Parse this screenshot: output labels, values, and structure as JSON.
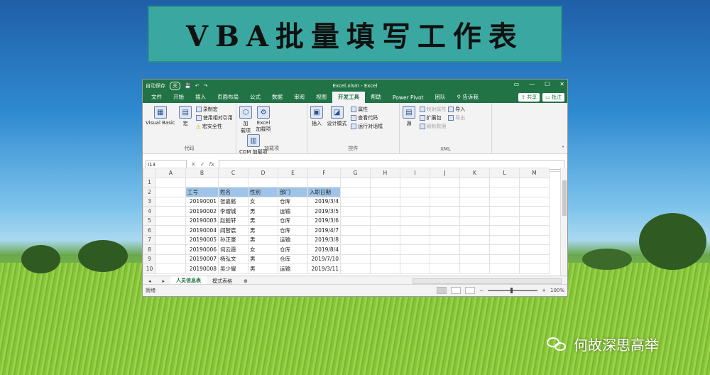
{
  "banner": {
    "title": "VBA批量填写工作表"
  },
  "window": {
    "autosave_label": "自动保存",
    "autosave_state": "关",
    "title": "Excel.xlsm  -  Excel",
    "controls": [
      "▭",
      "—",
      "☐",
      "✕"
    ]
  },
  "menu": {
    "items": [
      "文件",
      "开始",
      "插入",
      "页面布局",
      "公式",
      "数据",
      "审阅",
      "视图",
      "开发工具",
      "帮助",
      "Power Pivot",
      "团队",
      "告诉我"
    ],
    "active": "开发工具",
    "share": "共享",
    "comments": "批注"
  },
  "ribbon": {
    "code": {
      "name": "代码",
      "visual_basic": "Visual Basic",
      "macros": "宏",
      "record_macro": "录制宏",
      "relative_ref": "使用相对引用",
      "macro_security": "宏安全性"
    },
    "addins": {
      "name": "加载项",
      "addins": "加\n载项",
      "excel_addins": "Excel\n加载项",
      "com_addins": "COM 加载项"
    },
    "controls": {
      "name": "控件",
      "insert": "插入",
      "design_mode": "设计模式",
      "properties": "属性",
      "view_code": "查看代码",
      "run_dialog": "运行对话框"
    },
    "xml": {
      "name": "XML",
      "source": "源",
      "map_props": "映射属性",
      "expansion_packs": "扩展包",
      "refresh_data": "刷新数据",
      "import": "导入",
      "export": "导出"
    }
  },
  "formula_bar": {
    "name_box": "I13",
    "fx": "fx"
  },
  "columns": [
    "A",
    "B",
    "C",
    "D",
    "E",
    "F",
    "G",
    "H",
    "I",
    "J",
    "K",
    "L",
    "M"
  ],
  "headers": [
    "工号",
    "姓名",
    "性别",
    "部门",
    "入职日期"
  ],
  "rows": [
    {
      "row": "1"
    },
    {
      "row": "2",
      "header": true
    },
    {
      "row": "3",
      "id": "20190001",
      "name": "张嘉懿",
      "gender": "女",
      "dept": "仓库",
      "date": "2019/3/4"
    },
    {
      "row": "4",
      "id": "20190002",
      "name": "李熠城",
      "gender": "男",
      "dept": "运输",
      "date": "2019/3/5"
    },
    {
      "row": "5",
      "id": "20190003",
      "name": "赵懿轩",
      "gender": "男",
      "dept": "仓库",
      "date": "2019/3/6"
    },
    {
      "row": "6",
      "id": "20190004",
      "name": "阎智宸",
      "gender": "男",
      "dept": "仓库",
      "date": "2019/4/7"
    },
    {
      "row": "7",
      "id": "20190005",
      "name": "孙正豪",
      "gender": "男",
      "dept": "运输",
      "date": "2019/3/8"
    },
    {
      "row": "8",
      "id": "20190006",
      "name": "何云霞",
      "gender": "女",
      "dept": "仓库",
      "date": "2019/8/4"
    },
    {
      "row": "9",
      "id": "20190007",
      "name": "杨弘文",
      "gender": "男",
      "dept": "仓库",
      "date": "2019/7/10"
    },
    {
      "row": "10",
      "id": "20190008",
      "name": "吴少耀",
      "gender": "男",
      "dept": "运输",
      "date": "2019/3/11"
    }
  ],
  "sheets": [
    "人员信息表",
    "模式表格"
  ],
  "add_sheet": "⊕",
  "status": {
    "ready": "就绪",
    "zoom": "100%"
  },
  "watermark": {
    "text": "何故深思高举"
  },
  "icons": {
    "search": "search-icon",
    "wechat": "wechat-icon"
  },
  "colors": {
    "excel_green": "#217346",
    "header_fill": "#9fc4e8",
    "banner": "#3aa8a0"
  }
}
